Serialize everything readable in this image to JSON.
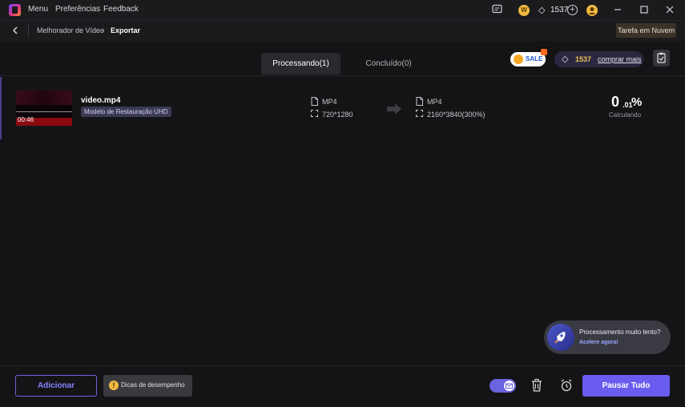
{
  "titlebar": {
    "menu": [
      "Menu",
      "Preferências",
      "Feedback"
    ],
    "credits": "1537",
    "coin_icon_label": "W"
  },
  "breadcrumb": {
    "items": [
      "Melhorador de Vídeo",
      "Exportar"
    ],
    "cloud_button": "Tarefa em Nuvem"
  },
  "tabs": {
    "processing": "Processando(1)",
    "done": "Concluído(0)"
  },
  "promo": {
    "sale_label": "SALE",
    "credits": "1537",
    "buy_label": "comprar mais"
  },
  "task": {
    "file_name": "video.mp4",
    "model": "Modelo de Restauração UHD",
    "duration": "00:46",
    "source": {
      "format": "MP4",
      "resolution": "720*1280"
    },
    "target": {
      "format": "MP4",
      "resolution": "2160*3840(300%)"
    },
    "progress_int": "0",
    "progress_dec": ".01",
    "progress_sign": "%",
    "status": "Calculando"
  },
  "speed_tip": {
    "question": "Processamento muito lento?",
    "action": "Acelere agora!"
  },
  "bottom": {
    "add_label": "Adicionar",
    "tips_label": "Dicas de desempenho",
    "pause_label": "Pausar Tudo"
  },
  "colors": {
    "accent": "#6b5cf0",
    "background": "#141416",
    "gold": "#f0b940"
  }
}
